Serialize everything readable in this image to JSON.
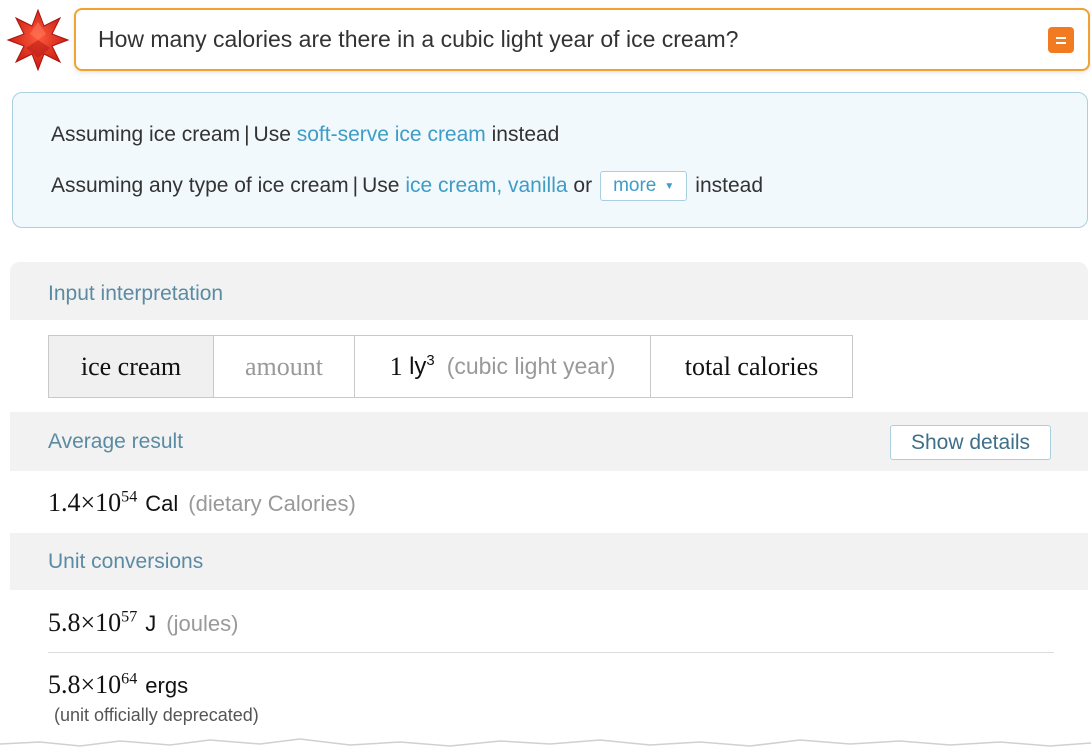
{
  "query": {
    "text": "How many calories are there in a cubic light year of ice cream?",
    "input_mode_icon": "equals-icon",
    "brand_color": "#f0a232"
  },
  "assumptions": {
    "line1": {
      "prefix": "Assuming ice cream",
      "separator": "|",
      "use": "Use",
      "link": "soft-serve ice cream",
      "suffix": "instead"
    },
    "line2": {
      "prefix": "Assuming any type of ice cream",
      "separator": "|",
      "use": "Use",
      "link": "ice cream, vanilla",
      "or": "or",
      "more": "more",
      "suffix": "instead"
    }
  },
  "pods": {
    "input_interpretation": {
      "title": "Input interpretation",
      "cells": {
        "item": "ice cream",
        "amount_label": "amount",
        "amount_value": "1",
        "amount_unit": "ly",
        "amount_exponent": "3",
        "amount_hint": "(cubic light year)",
        "property": "total calories"
      }
    },
    "average_result": {
      "title": "Average result",
      "show_details": "Show details",
      "mantissa": "1.4",
      "times": "×",
      "base": "10",
      "exponent": "54",
      "unit": "Cal",
      "unit_desc": "(dietary Calories)"
    },
    "unit_conversions": {
      "title": "Unit conversions",
      "rows": [
        {
          "mantissa": "5.8",
          "times": "×",
          "base": "10",
          "exponent": "57",
          "unit": "J",
          "unit_desc": "(joules)"
        },
        {
          "mantissa": "5.8",
          "times": "×",
          "base": "10",
          "exponent": "64",
          "unit": "ergs",
          "note": "(unit officially deprecated)"
        }
      ]
    }
  },
  "colors": {
    "link": "#3e9cc7",
    "pod_title": "#5a8ba3",
    "assumption_bg": "#f2f9fc",
    "input_mode_button": "#f27a20"
  }
}
